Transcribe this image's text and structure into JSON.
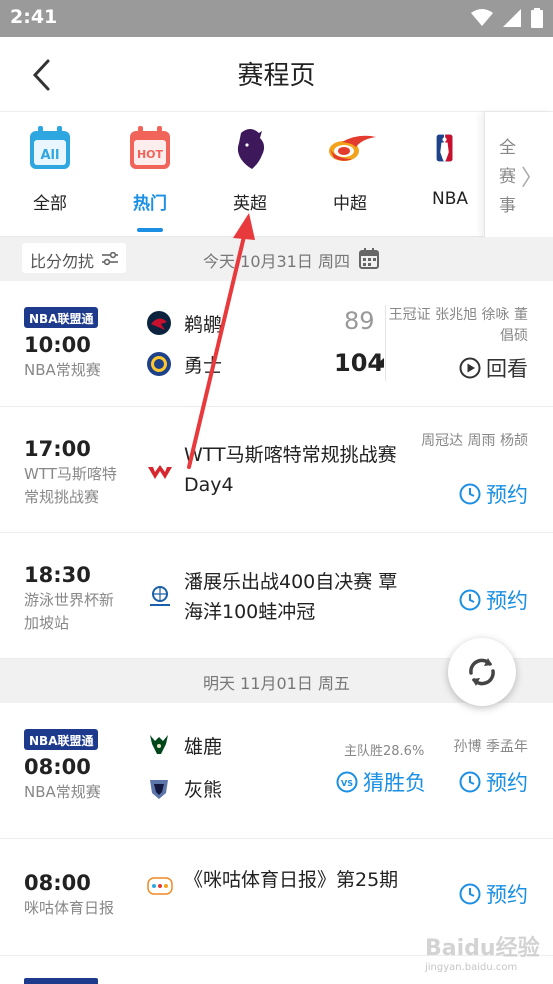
{
  "status_bar": {
    "time": "2:41"
  },
  "header": {
    "title": "赛程页"
  },
  "categories": [
    {
      "label": "全部",
      "icon": "calendar-all-icon",
      "icon_text": "All"
    },
    {
      "label": "热门",
      "icon": "calendar-hot-icon",
      "icon_text": "HOT",
      "active": true
    },
    {
      "label": "英超",
      "icon": "premier-league-icon"
    },
    {
      "label": "中超",
      "icon": "csl-icon"
    },
    {
      "label": "NBA",
      "icon": "nba-icon"
    }
  ],
  "all_events_label": "全赛事",
  "filter": {
    "label": "比分勿扰"
  },
  "days": [
    {
      "date": "今天 10月31日 周四"
    },
    {
      "date": "明天 11月01日 周五"
    }
  ],
  "matches": [
    {
      "badge": "NBA联盟通",
      "time": "10:00",
      "type": "NBA常规赛",
      "home": "鹈鹕",
      "away": "勇士",
      "home_score": "89",
      "away_score": "104",
      "commentator": "王冠证 张兆旭 徐咏 董倡硕",
      "action": "回看"
    },
    {
      "time": "17:00",
      "type": "WTT马斯喀特常规挑战赛",
      "event": "WTT马斯喀特常规挑战赛Day4",
      "commentator": "周冠达 周雨 杨颉",
      "action": "预约"
    },
    {
      "time": "18:30",
      "type": "游泳世界杯新加坡站",
      "event": "潘展乐出战400自决赛 覃海洋100蛙冲冠",
      "action": "预约"
    },
    {
      "badge": "NBA联盟通",
      "time": "08:00",
      "type": "NBA常规赛",
      "home": "雄鹿",
      "away": "灰熊",
      "stat": "主队胜28.6%",
      "guess": "猜胜负",
      "commentator": "孙博 季孟年",
      "action": "预约"
    },
    {
      "time": "08:00",
      "type": "咪咕体育日报",
      "event": "《咪咕体育日报》第25期",
      "action": "预约"
    }
  ],
  "watermark": {
    "text": "Baidu经验",
    "sub": "jingyan.baidu.com"
  },
  "colors": {
    "accent": "#1a8fe3",
    "nba_badge": "#1d3a8c",
    "arrow": "#e8393d"
  }
}
